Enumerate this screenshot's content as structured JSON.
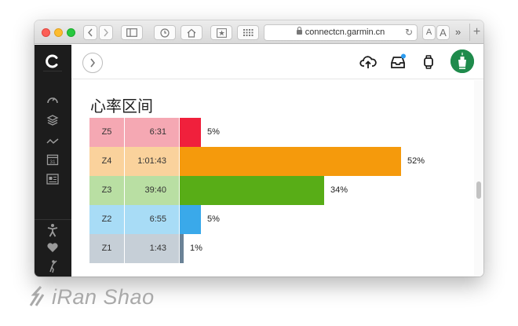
{
  "browser": {
    "url": "connectcn.garmin.cn",
    "reader_small": "A",
    "reader_large": "A",
    "overflow": "»",
    "new_tab": "+"
  },
  "page": {
    "section_title": "心率区间"
  },
  "zones": [
    {
      "label": "Z5",
      "time": "6:31",
      "percent": "5%",
      "fraction": 0.05,
      "bar_color": "#f0203c",
      "cell_color": "#f5a8b3"
    },
    {
      "label": "Z4",
      "time": "1:01:43",
      "percent": "52%",
      "fraction": 0.52,
      "bar_color": "#f59a0c",
      "cell_color": "#fad29c"
    },
    {
      "label": "Z3",
      "time": "39:40",
      "percent": "34%",
      "fraction": 0.34,
      "bar_color": "#58ad17",
      "cell_color": "#b9dfa3"
    },
    {
      "label": "Z2",
      "time": "6:55",
      "percent": "5%",
      "fraction": 0.05,
      "bar_color": "#3aa9ea",
      "cell_color": "#a8dcf6"
    },
    {
      "label": "Z1",
      "time": "1:43",
      "percent": "1%",
      "fraction": 0.01,
      "bar_color": "#6b8397",
      "cell_color": "#c6cfd7"
    }
  ],
  "icons": {
    "sidebar": [
      "dashboard-icon",
      "layers-icon",
      "trend-icon",
      "calendar-icon",
      "reports-icon",
      "activity-person-icon",
      "heart-icon",
      "golf-icon",
      "more-icon"
    ],
    "calendar_day": "31",
    "topbar": [
      "upload-cloud-icon",
      "inbox-icon",
      "watch-icon",
      "avatar"
    ]
  },
  "watermark": "iRan Shao"
}
